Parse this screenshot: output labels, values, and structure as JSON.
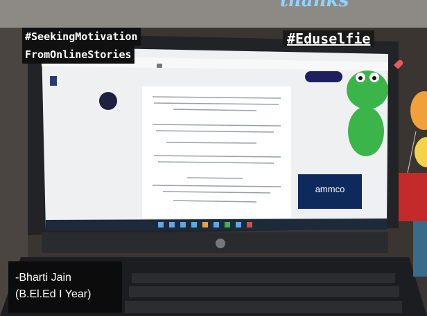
{
  "overlays": {
    "hashtag_left_line1": "#SeekingMotivation",
    "hashtag_left_line2": "FromOnlineStories",
    "hashtag_right": "#Eduselfie",
    "credit_name": "-Bharti Jain",
    "credit_class": "(B.El.Ed I Year)",
    "top_script": "thanks"
  },
  "screen": {
    "ad_brand": "ammco"
  },
  "colors": {
    "screen_bg": "#eef0f2",
    "laptop_body": "#2a2b2f",
    "keyboard": "#1c1d20",
    "taskbar": "#1c2a3a",
    "accent_green": "#3bb54a",
    "balloon_orange": "#f2a13a"
  }
}
